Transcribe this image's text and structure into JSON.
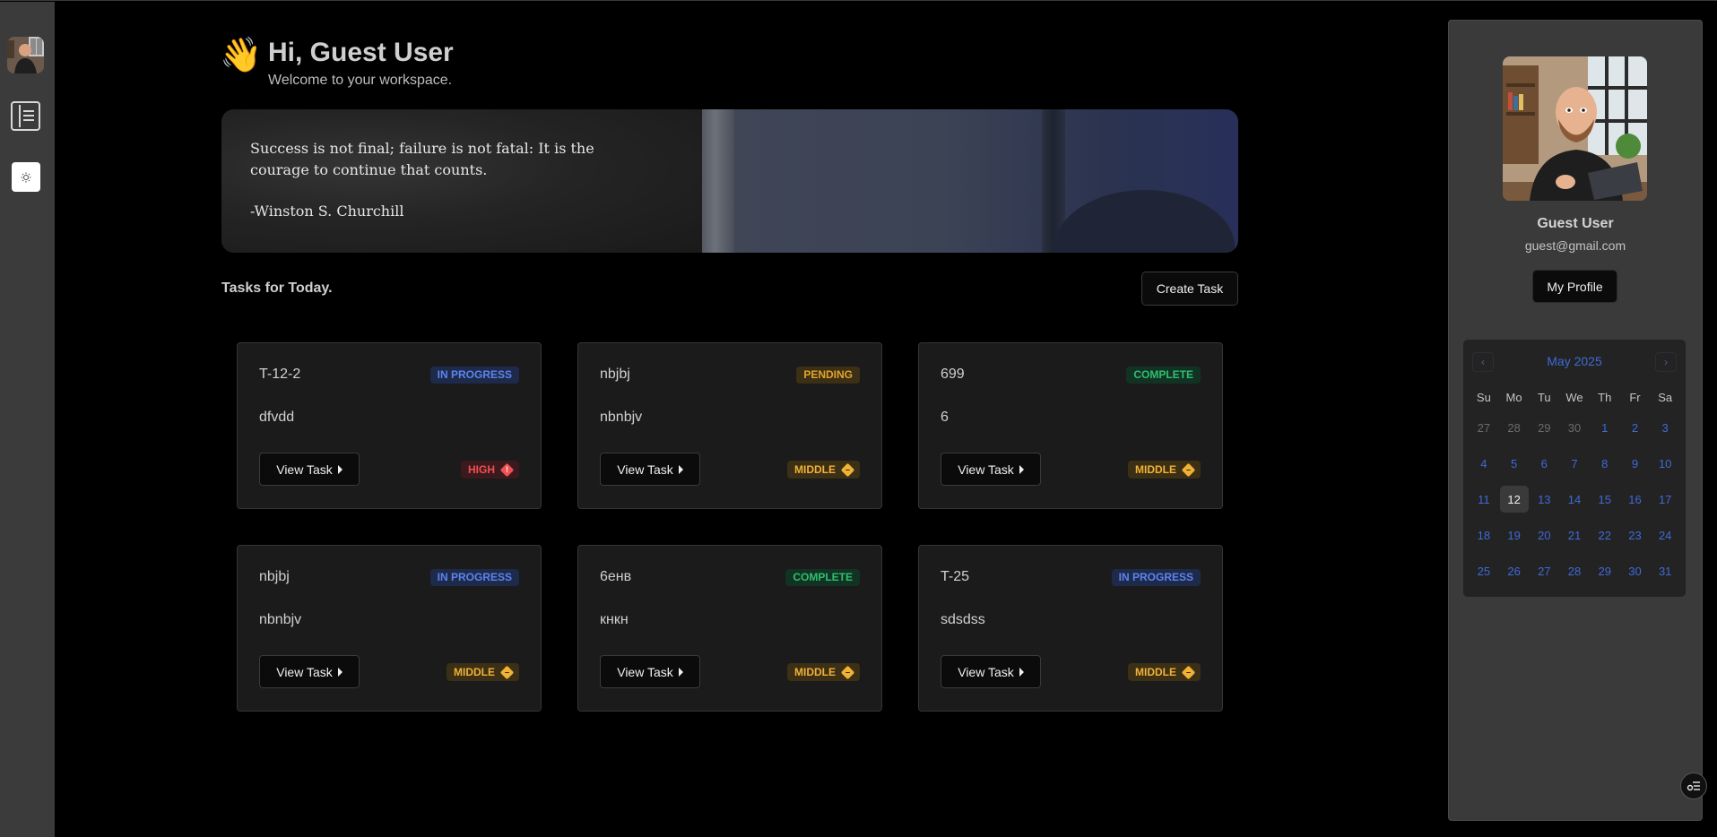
{
  "greeting": {
    "wave": "👋",
    "title": "Hi, Guest User",
    "subtitle": "Welcome to your workspace."
  },
  "quote": {
    "text": "Success is not final; failure is not fatal: It is the courage to continue that counts.",
    "author": "-Winston S. Churchill"
  },
  "tasks": {
    "heading": "Tasks for Today.",
    "create_label": "Create Task",
    "view_label": "View Task",
    "items": [
      {
        "title": "T-12-2",
        "desc": "dfvdd",
        "status": "IN PROGRESS",
        "priority": "HIGH"
      },
      {
        "title": "nbjbj",
        "desc": "nbnbjv",
        "status": "PENDING",
        "priority": "MIDDLE"
      },
      {
        "title": "699",
        "desc": "6",
        "status": "COMPLETE",
        "priority": "MIDDLE"
      },
      {
        "title": "nbjbj",
        "desc": "nbnbjv",
        "status": "IN PROGRESS",
        "priority": "MIDDLE"
      },
      {
        "title": "6енв",
        "desc": "кнкн",
        "status": "COMPLETE",
        "priority": "MIDDLE"
      },
      {
        "title": "T-25",
        "desc": "sdsdss",
        "status": "IN PROGRESS",
        "priority": "MIDDLE"
      }
    ]
  },
  "profile": {
    "name": "Guest User",
    "email": "guest@gmail.com",
    "button_label": "My Profile"
  },
  "calendar": {
    "month_label": "May 2025",
    "prev_icon": "‹",
    "next_icon": "›",
    "weekdays": [
      "Su",
      "Mo",
      "Tu",
      "We",
      "Th",
      "Fr",
      "Sa"
    ],
    "weeks": [
      [
        "27",
        "28",
        "29",
        "30",
        "1",
        "2",
        "3"
      ],
      [
        "4",
        "5",
        "6",
        "7",
        "8",
        "9",
        "10"
      ],
      [
        "11",
        "12",
        "13",
        "14",
        "15",
        "16",
        "17"
      ],
      [
        "18",
        "19",
        "20",
        "21",
        "22",
        "23",
        "24"
      ],
      [
        "25",
        "26",
        "27",
        "28",
        "29",
        "30",
        "31"
      ]
    ],
    "selected": "12"
  },
  "colors": {
    "accent_blue": "#3f6ad8",
    "status_progress": "#5c84f0",
    "status_pending": "#e3a42b",
    "status_complete": "#2fbf6e",
    "priority_high": "#ef4f55",
    "priority_middle": "#f0b137"
  },
  "icons": {
    "sidebar": [
      "user-avatar",
      "task-list-icon",
      "theme-toggle-icon"
    ],
    "floating": "settings-filter-icon"
  }
}
